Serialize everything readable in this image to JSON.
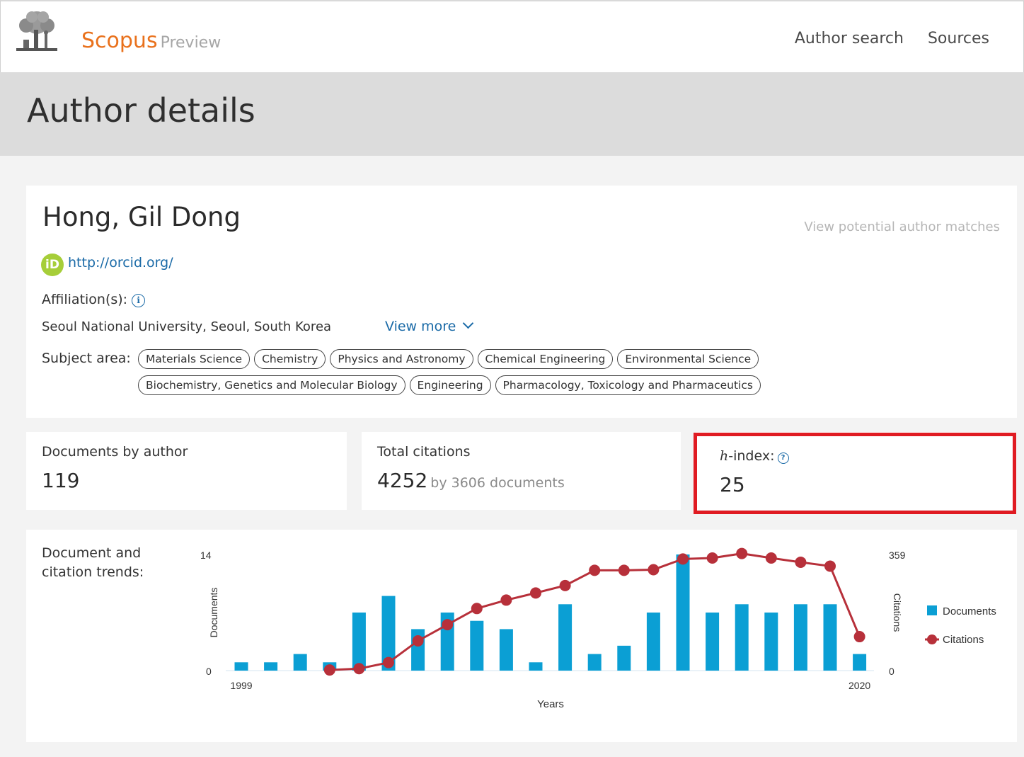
{
  "header": {
    "brand": "Scopus",
    "brand_sub": "Preview",
    "nav": {
      "author_search": "Author search",
      "sources": "Sources"
    }
  },
  "page": {
    "title": "Author details"
  },
  "author": {
    "name": "Hong, Gil Dong",
    "potential_matches": "View potential author matches",
    "orcid_icon_text": "iD",
    "orcid_url": "http://orcid.org/",
    "affiliation_label": "Affiliation(s):",
    "affiliation": "Seoul National University, Seoul, South Korea",
    "view_more": "View more",
    "subject_label": "Subject area:",
    "subjects_row1": [
      "Materials Science",
      "Chemistry",
      "Physics and Astronomy",
      "Chemical Engineering",
      "Environmental Science"
    ],
    "subjects_row2": [
      "Biochemistry, Genetics and Molecular Biology",
      "Engineering",
      "Pharmacology, Toxicology and Pharmaceutics"
    ]
  },
  "metrics": {
    "documents": {
      "label": "Documents by author",
      "value": "119"
    },
    "citations": {
      "label": "Total citations",
      "value": "4252",
      "sub": "by 3606 documents"
    },
    "hindex": {
      "label_italic": "h",
      "label_rest": "-index:",
      "value": "25"
    }
  },
  "trend": {
    "label": "Document and citation trends:"
  },
  "chart_data": {
    "type": "bar",
    "xlabel": "Years",
    "ylabel": "Documents",
    "y2label": "Citations",
    "x_tick_labels": [
      "1999",
      "2020"
    ],
    "categories": [
      "1999",
      "2000",
      "2001",
      "2002",
      "2003",
      "2004",
      "2005",
      "2006",
      "2007",
      "2008",
      "2009",
      "2010",
      "2011",
      "2012",
      "2013",
      "2014",
      "2015",
      "2016",
      "2017",
      "2018",
      "2019",
      "2020"
    ],
    "ylim": [
      0,
      14
    ],
    "y2lim": [
      0,
      359
    ],
    "y_ticks": [
      "0",
      "14"
    ],
    "y2_ticks": [
      "0",
      "359"
    ],
    "legend_position": "right",
    "series": [
      {
        "name": "Documents",
        "type": "bar",
        "color": "#0b9fd4",
        "values": [
          1,
          1,
          2,
          1,
          7,
          9,
          5,
          7,
          6,
          5,
          1,
          8,
          2,
          3,
          7,
          14,
          7,
          8,
          7,
          8,
          8,
          2
        ]
      },
      {
        "name": "Citations",
        "type": "line",
        "color": "#b7303a",
        "x": [
          "2002",
          "2003",
          "2004",
          "2005",
          "2006",
          "2007",
          "2008",
          "2009",
          "2010",
          "2011",
          "2012",
          "2013",
          "2014",
          "2015",
          "2016",
          "2017",
          "2018",
          "2019",
          "2020"
        ],
        "values": [
          2,
          6,
          25,
          92,
          142,
          192,
          218,
          240,
          263,
          310,
          310,
          312,
          345,
          348,
          362,
          348,
          335,
          323,
          105
        ]
      }
    ]
  }
}
